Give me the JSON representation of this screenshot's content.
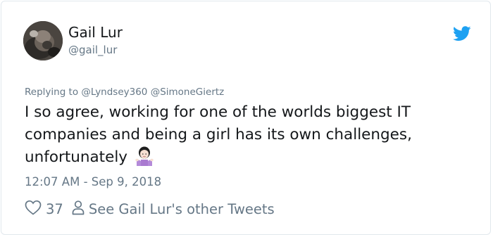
{
  "tweet": {
    "author": {
      "name": "Gail Lur",
      "handle": "@gail_lur"
    },
    "replying_prefix": "Replying to",
    "reply_mentions": [
      "@Lyndsey360",
      "@SimoneGiertz"
    ],
    "text_lines": [
      "I so agree, working for one of the worlds biggest IT",
      "companies and being a girl has its own challenges,",
      "unfortunately"
    ],
    "emoji": "woman-shrugging-emoji",
    "timestamp": "12:07 AM - Sep 9, 2018",
    "like_count": "37",
    "other_tweets_label": "See Gail Lur's other Tweets"
  },
  "colors": {
    "primary_text": "#14171a",
    "secondary_text": "#657786",
    "twitter_blue": "#1da1f2",
    "border": "#e1e8ed"
  },
  "icons": {
    "brand": "twitter-bird-icon",
    "like": "heart-icon",
    "profile": "person-icon"
  }
}
